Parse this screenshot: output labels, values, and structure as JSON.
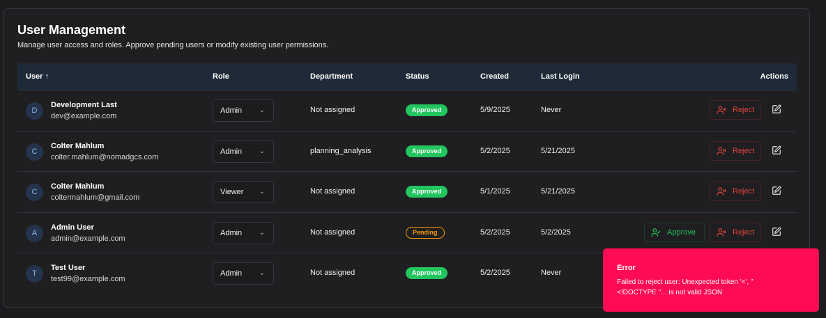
{
  "header": {
    "title": "User Management",
    "subtitle": "Manage user access and roles. Approve pending users or modify existing user permissions."
  },
  "table": {
    "columns": {
      "user": "User ↑",
      "role": "Role",
      "department": "Department",
      "status": "Status",
      "created": "Created",
      "last_login": "Last Login",
      "actions": "Actions"
    },
    "rows": [
      {
        "initial": "D",
        "name": "Development Last",
        "email": "dev@example.com",
        "role": "Admin",
        "department": "Not assigned",
        "status": "Approved",
        "created": "5/9/2025",
        "last_login": "Never"
      },
      {
        "initial": "C",
        "name": "Colter Mahlum",
        "email": "colter.mahlum@nomadgcs.com",
        "role": "Admin",
        "department": "planning_analysis",
        "status": "Approved",
        "created": "5/2/2025",
        "last_login": "5/21/2025"
      },
      {
        "initial": "C",
        "name": "Colter Mahlum",
        "email": "coltermahlum@gmail.com",
        "role": "Viewer",
        "department": "Not assigned",
        "status": "Approved",
        "created": "5/1/2025",
        "last_login": "5/21/2025"
      },
      {
        "initial": "A",
        "name": "Admin User",
        "email": "admin@example.com",
        "role": "Admin",
        "department": "Not assigned",
        "status": "Pending",
        "created": "5/2/2025",
        "last_login": "5/2/2025"
      },
      {
        "initial": "T",
        "name": "Test User",
        "email": "test99@example.com",
        "role": "Admin",
        "department": "Not assigned",
        "status": "Approved",
        "created": "5/2/2025",
        "last_login": "Never"
      }
    ]
  },
  "actions": {
    "approve_label": "Approve",
    "reject_label": "Reject"
  },
  "toast": {
    "title": "Error",
    "message": "Failed to reject user: Unexpected token '<', \"<!DOCTYPE \"... is not valid JSON"
  },
  "colors": {
    "approved": "#22c55e",
    "pending": "#f59e0b",
    "reject": "#e0453c",
    "toast_bg": "#ff0a54"
  }
}
